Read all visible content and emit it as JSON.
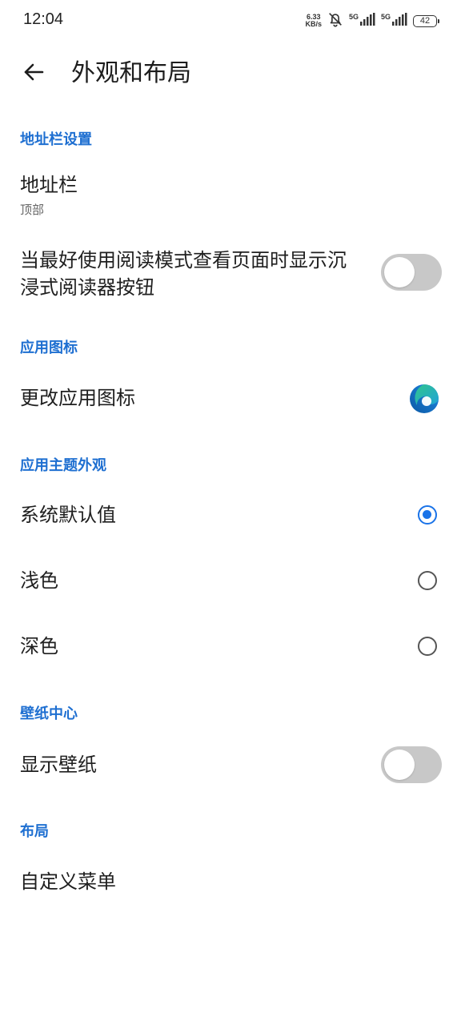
{
  "status_bar": {
    "time": "12:04",
    "speed_value": "6.33",
    "speed_unit": "KB/s",
    "net1": "5G",
    "net2": "5G",
    "battery": "42"
  },
  "header": {
    "title": "外观和布局"
  },
  "sections": {
    "address_bar": {
      "header": "地址栏设置",
      "address_bar_item": {
        "title": "地址栏",
        "subtitle": "顶部"
      },
      "immersive_reader": {
        "title_line1": "当最好使用阅读模式查看页面时显示沉",
        "title_line2": "浸式阅读器按钮",
        "enabled": false
      }
    },
    "app_icon": {
      "header": "应用图标",
      "change_icon": {
        "title": "更改应用图标",
        "icon": "edge-icon"
      }
    },
    "theme": {
      "header": "应用主题外观",
      "options": [
        {
          "label": "系统默认值",
          "selected": true
        },
        {
          "label": "浅色",
          "selected": false
        },
        {
          "label": "深色",
          "selected": false
        }
      ]
    },
    "wallpaper": {
      "header": "壁纸中心",
      "show_wallpaper": {
        "title": "显示壁纸",
        "enabled": false
      }
    },
    "layout": {
      "header": "布局",
      "custom_menu": {
        "title": "自定义菜单"
      }
    }
  },
  "colors": {
    "accent": "#1a73e8",
    "section_header": "#1e6fd1",
    "toggle_off": "#c8c8c8"
  }
}
